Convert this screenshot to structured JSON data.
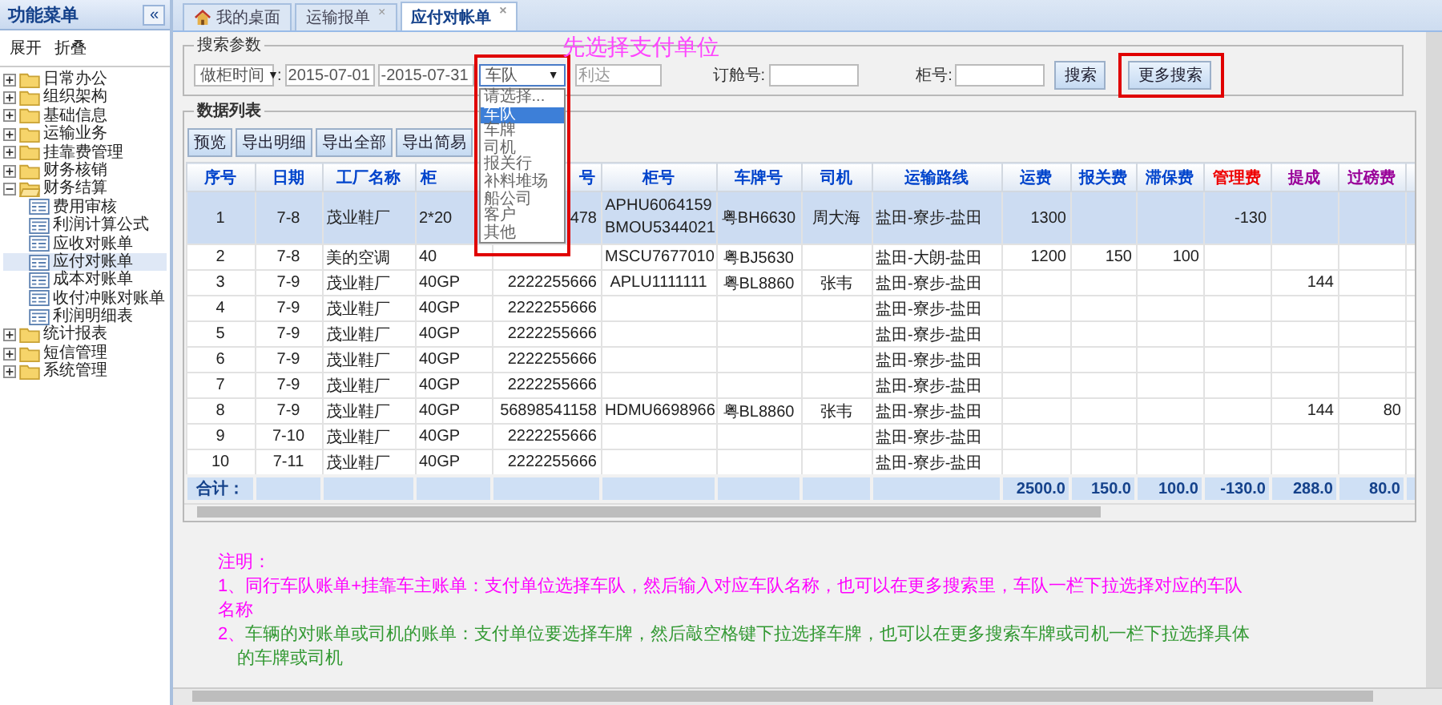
{
  "sidebar": {
    "title": "功能菜单",
    "collapse": "«",
    "actions": [
      "展开",
      "折叠"
    ],
    "items": [
      {
        "label": "日常办公",
        "expanded": false
      },
      {
        "label": "组织架构",
        "expanded": false
      },
      {
        "label": "基础信息",
        "expanded": false
      },
      {
        "label": "运输业务",
        "expanded": false
      },
      {
        "label": "挂靠费管理",
        "expanded": false
      },
      {
        "label": "财务核销",
        "expanded": false
      },
      {
        "label": "财务结算",
        "expanded": true,
        "children": [
          {
            "label": "费用审核",
            "selected": false
          },
          {
            "label": "利润计算公式",
            "selected": false
          },
          {
            "label": "应收对账单",
            "selected": false
          },
          {
            "label": "应付对账单",
            "selected": true
          },
          {
            "label": "成本对账单",
            "selected": false
          },
          {
            "label": "收付冲账对账单",
            "selected": false
          },
          {
            "label": "利润明细表",
            "selected": false
          }
        ]
      },
      {
        "label": "统计报表",
        "expanded": false
      },
      {
        "label": "短信管理",
        "expanded": false
      },
      {
        "label": "系统管理",
        "expanded": false
      }
    ]
  },
  "tabs": [
    {
      "label": "我的桌面",
      "kind": "home",
      "selected": false
    },
    {
      "label": "运输报单",
      "close": "×",
      "selected": false
    },
    {
      "label": "应付对帐单",
      "close": "×",
      "selected": true
    }
  ],
  "search": {
    "legend": "搜索参数",
    "date_type": {
      "value": "做柜时间",
      "arrow": "▼"
    },
    "colon": ":",
    "date_from": "2015-07-01",
    "date_to": "-2015-07-31",
    "payer": {
      "value": "车队",
      "arrow": "▼",
      "options": [
        {
          "label": "请选择...",
          "selected": false
        },
        {
          "label": "车队",
          "selected": true
        },
        {
          "label": "车牌",
          "selected": false
        },
        {
          "label": "司机",
          "selected": false
        },
        {
          "label": "报关行",
          "selected": false
        },
        {
          "label": "补料堆场",
          "selected": false
        },
        {
          "label": "船公司",
          "selected": false
        },
        {
          "label": "客户",
          "selected": false
        },
        {
          "label": "其他",
          "selected": false
        }
      ]
    },
    "payer_name": "利达",
    "booking_label": "订舱号:",
    "container_label": "柜号:",
    "search_button": "搜索",
    "more_button": "更多搜索"
  },
  "annotation": "先选择支付单位",
  "data_list": {
    "legend": "数据列表",
    "buttons": [
      "预览",
      "导出明细",
      "导出全部",
      "导出简易"
    ]
  },
  "table": {
    "columns": [
      {
        "label": "序号",
        "color": "#0044cc"
      },
      {
        "label": "日期",
        "color": "#0044cc"
      },
      {
        "label": "工厂名称",
        "color": "#0044cc"
      },
      {
        "label": "柜",
        "color": "#0044cc"
      },
      {
        "label": "号",
        "color": "#0044cc"
      },
      {
        "label": "柜号",
        "color": "#0044cc"
      },
      {
        "label": "车牌号",
        "color": "#0044cc"
      },
      {
        "label": "司机",
        "color": "#0044cc"
      },
      {
        "label": "运输路线",
        "color": "#0044cc"
      },
      {
        "label": "运费",
        "color": "#0044cc"
      },
      {
        "label": "报关费",
        "color": "#0044cc"
      },
      {
        "label": "滞保费",
        "color": "#0044cc"
      },
      {
        "label": "管理费",
        "color": "#ee0000"
      },
      {
        "label": "提成",
        "color": "#990099"
      },
      {
        "label": "过磅费",
        "color": "#990099"
      }
    ],
    "rows": [
      {
        "selected": true,
        "cells": [
          "1",
          "7-8",
          "茂业鞋厂",
          "2*20",
          "478",
          [
            "APHU6064159",
            "BMOU5344021"
          ],
          "粤BH6630",
          "周大海",
          "盐田-寮步-盐田",
          "1300",
          null,
          null,
          "-130",
          null,
          null
        ]
      },
      {
        "selected": false,
        "cells": [
          "2",
          "7-8",
          "美的空调",
          "40",
          null,
          "MSCU7677010",
          "粤BJ5630",
          null,
          "盐田-大朗-盐田",
          "1200",
          "150",
          "100",
          null,
          null,
          null
        ]
      },
      {
        "selected": false,
        "cells": [
          "3",
          "7-9",
          "茂业鞋厂",
          "40GP",
          "2222255666",
          "APLU1111111",
          "粤BL8860",
          "张韦",
          "盐田-寮步-盐田",
          null,
          null,
          null,
          null,
          "144",
          null
        ]
      },
      {
        "selected": false,
        "cells": [
          "4",
          "7-9",
          "茂业鞋厂",
          "40GP",
          "2222255666",
          null,
          null,
          null,
          "盐田-寮步-盐田",
          null,
          null,
          null,
          null,
          null,
          null
        ]
      },
      {
        "selected": false,
        "cells": [
          "5",
          "7-9",
          "茂业鞋厂",
          "40GP",
          "2222255666",
          null,
          null,
          null,
          "盐田-寮步-盐田",
          null,
          null,
          null,
          null,
          null,
          null
        ]
      },
      {
        "selected": false,
        "cells": [
          "6",
          "7-9",
          "茂业鞋厂",
          "40GP",
          "2222255666",
          null,
          null,
          null,
          "盐田-寮步-盐田",
          null,
          null,
          null,
          null,
          null,
          null
        ]
      },
      {
        "selected": false,
        "cells": [
          "7",
          "7-9",
          "茂业鞋厂",
          "40GP",
          "2222255666",
          null,
          null,
          null,
          "盐田-寮步-盐田",
          null,
          null,
          null,
          null,
          null,
          null
        ]
      },
      {
        "selected": false,
        "cells": [
          "8",
          "7-9",
          "茂业鞋厂",
          "40GP",
          "56898541158",
          "HDMU6698966",
          "粤BL8860",
          "张韦",
          "盐田-寮步-盐田",
          null,
          null,
          null,
          null,
          "144",
          "80"
        ]
      },
      {
        "selected": false,
        "cells": [
          "9",
          "7-10",
          "茂业鞋厂",
          "40GP",
          "2222255666",
          null,
          null,
          null,
          "盐田-寮步-盐田",
          null,
          null,
          null,
          null,
          null,
          null
        ]
      },
      {
        "selected": false,
        "cells": [
          "10",
          "7-11",
          "茂业鞋厂",
          "40GP",
          "2222255666",
          null,
          null,
          null,
          "盐田-寮步-盐田",
          null,
          null,
          null,
          null,
          null,
          null
        ]
      }
    ],
    "totals": {
      "label": "合计：",
      "values": [
        "2500.0",
        "150.0",
        "100.0",
        "-130.0",
        "288.0",
        "80.0"
      ]
    }
  },
  "notes": {
    "title": "注明：",
    "items": [
      {
        "number": "1、",
        "text": "同行车队账单+挂靠车主账单：支付单位选择车队，然后输入对应车队名称，也可以在更多搜索里，车队一栏下拉选择对应的车队名称",
        "color": "#ff00ff"
      },
      {
        "number": "2、",
        "text": "车辆的对账单或司机的账单：支付单位要选择车牌，然后敲空格键下拉选择车牌，也可以在更多搜索车牌或司机一栏下拉选择具体的车牌或司机",
        "color": "#339933"
      }
    ]
  }
}
